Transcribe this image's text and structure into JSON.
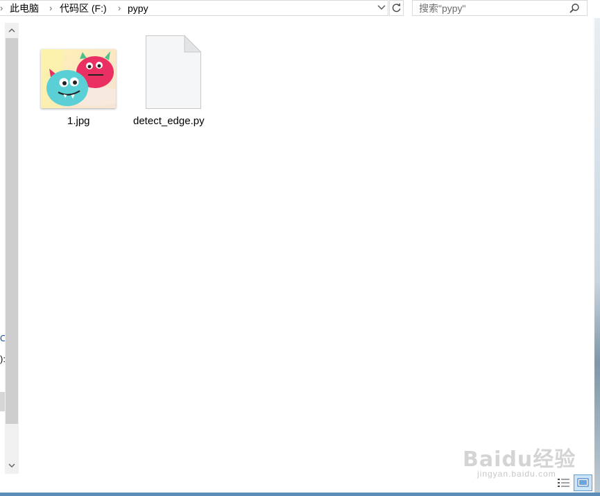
{
  "address_bar": {
    "breadcrumbs": [
      "此电脑",
      "代码区 (F:)",
      "pypy"
    ],
    "refresh_icon": "refresh-icon",
    "dropdown_icon": "chevron-down-icon"
  },
  "search": {
    "placeholder": "搜索\"pypy\"",
    "icon": "search-icon"
  },
  "files": [
    {
      "name": "1.jpg",
      "type": "image-thumbnail"
    },
    {
      "name": "detect_edge.py",
      "type": "document-icon"
    }
  ],
  "navigation_fragments": [
    "O",
    "):"
  ],
  "view_modes": [
    "details-view-icon",
    "large-icons-view-icon"
  ],
  "watermark": {
    "logo": "Baidu经验",
    "url": "jingyan.baidu.com"
  },
  "colors": {
    "accent": "#5b9bd5",
    "border": "#d9d9d9",
    "scroll_thumb": "#cdcdcd"
  }
}
